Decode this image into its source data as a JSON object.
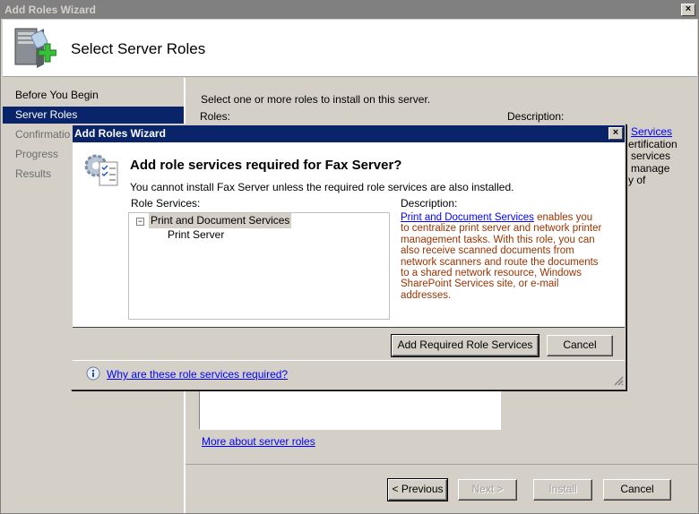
{
  "window": {
    "title": "Add Roles Wizard",
    "close": "×"
  },
  "header": {
    "title": "Select Server Roles",
    "icon": "server-add-icon"
  },
  "nav": {
    "items": [
      {
        "label": "Before You Begin",
        "state": "normal"
      },
      {
        "label": "Server Roles",
        "state": "active"
      },
      {
        "label": "Confirmation",
        "state": "dim"
      },
      {
        "label": "Progress",
        "state": "dim"
      },
      {
        "label": "Results",
        "state": "dim"
      }
    ]
  },
  "content": {
    "instruction": "Select one or more roles to install on this server.",
    "roles_label": "Roles:",
    "description_label": "Description:",
    "description_fragments": {
      "link": "Services",
      "lines": [
        "ertification",
        "services",
        "manage",
        "y of"
      ]
    },
    "more_link": "More about server roles"
  },
  "footer": {
    "previous": "< Previous",
    "next": "Next >",
    "install": "Install",
    "cancel": "Cancel"
  },
  "dialog": {
    "title": "Add Roles Wizard",
    "close": "×",
    "heading": "Add role services required for Fax Server?",
    "message": "You cannot install Fax Server unless the required role services are also installed.",
    "role_services_label": "Role Services:",
    "tree": {
      "parent": "Print and Document Services",
      "expander": "−",
      "child": "Print Server"
    },
    "description_label": "Description:",
    "description_link": "Print and Document Services",
    "description_text": " enables you to centralize print server and network printer management tasks. With this role, you can also receive scanned documents from network scanners and route the documents to a shared network resource, Windows SharePoint Services site, or e-mail addresses.",
    "add_button": "Add Required Role Services",
    "cancel_button": "Cancel",
    "help_link": "Why are these role services required?"
  },
  "colors": {
    "active_title": "#0a246a",
    "inactive_title": "#808080",
    "face": "#d4d0c8",
    "link": "#0000ff",
    "description_text": "#993300"
  }
}
